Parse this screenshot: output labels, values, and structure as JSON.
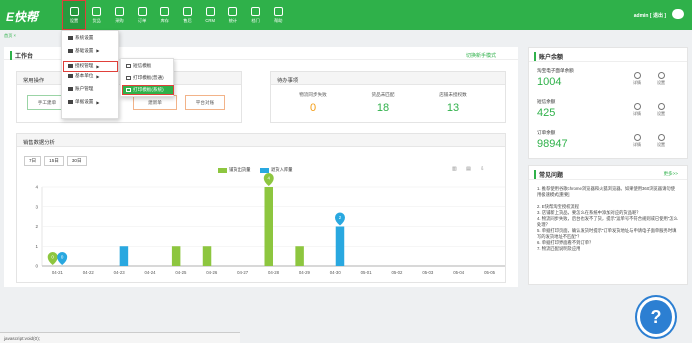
{
  "app": {
    "logo": "E快帮",
    "user": "admin",
    "logout": "[ 退出 ]"
  },
  "nav": [
    {
      "label": "设置",
      "icon": "gear-icon",
      "active": true
    },
    {
      "label": "货品",
      "icon": "box-icon"
    },
    {
      "label": "采购",
      "icon": "cart-icon"
    },
    {
      "label": "订单",
      "icon": "order-icon"
    },
    {
      "label": "库存",
      "icon": "warehouse-icon"
    },
    {
      "label": "售后",
      "icon": "service-icon"
    },
    {
      "label": "CRM",
      "icon": "crm-icon"
    },
    {
      "label": "统计",
      "icon": "stats-icon"
    },
    {
      "label": "档门",
      "icon": "door-icon"
    },
    {
      "label": "帮助",
      "icon": "help-icon"
    }
  ],
  "breadcrumb": "首页 ×",
  "dropdown": [
    {
      "label": "系统设置",
      "arrow": ""
    },
    {
      "label": "基础设置",
      "arrow": "▶"
    },
    {
      "label": "授权管理",
      "arrow": "▶",
      "selected": true
    },
    {
      "label": "基本单位",
      "arrow": "▶"
    },
    {
      "label": "账户管理",
      "arrow": ""
    },
    {
      "label": "单据设置",
      "arrow": "▶"
    }
  ],
  "submenu": [
    {
      "label": "短信模板"
    },
    {
      "label": "打印模板(普通)"
    },
    {
      "label": "打印模板(系统)",
      "highlighted": true
    }
  ],
  "workbench": {
    "title": "工作台",
    "switch_label": "切换新手模式"
  },
  "common_ops": {
    "title": "常用操作",
    "buttons": [
      "手工建单",
      "平台对账"
    ],
    "partial": "建新单"
  },
  "pending": {
    "title": "待办事项",
    "items": [
      {
        "label": "物流同步失败",
        "value": "0",
        "color": "#f39c12"
      },
      {
        "label": "货品未匹配",
        "value": "18",
        "color": "#2fb14a"
      },
      {
        "label": "店铺未授权数",
        "value": "13",
        "color": "#2fb14a"
      }
    ]
  },
  "sales": {
    "title": "销售数据分析",
    "tabs": [
      "7日",
      "15日",
      "30日"
    ],
    "legend": [
      {
        "name": "铺货出货量",
        "color": "#8dc63f"
      },
      {
        "name": "退货入库量",
        "color": "#29a8e0"
      }
    ]
  },
  "chart_data": {
    "type": "bar",
    "categories": [
      "04-21",
      "04-22",
      "04-23",
      "04-24",
      "04-25",
      "04-26",
      "04-27",
      "04-28",
      "04-29",
      "04-30",
      "05-01",
      "05-02",
      "05-03",
      "05-04",
      "05-05"
    ],
    "series": [
      {
        "name": "铺货出货量",
        "color": "#8dc63f",
        "values": [
          0,
          0,
          0,
          0,
          1,
          1,
          0,
          4,
          1,
          0,
          0,
          0,
          0,
          0,
          0
        ]
      },
      {
        "name": "退货入库量",
        "color": "#29a8e0",
        "values": [
          0,
          0,
          1,
          0,
          0,
          0,
          0,
          0,
          0,
          2,
          0,
          0,
          0,
          0,
          0
        ]
      }
    ],
    "yticks": [
      "0",
      "1",
      "2",
      "3",
      "4"
    ],
    "ylim": [
      0,
      4
    ],
    "markers": [
      {
        "category": "04-21",
        "series": 0,
        "label": "0"
      },
      {
        "category": "04-21",
        "series": 1,
        "label": "0"
      },
      {
        "category": "04-28",
        "series": 0,
        "label": "4"
      },
      {
        "category": "04-30",
        "series": 1,
        "label": "2"
      }
    ]
  },
  "account": {
    "title": "账户余额",
    "items": [
      {
        "label": "淘宝电子面单余额",
        "value": "1004"
      },
      {
        "label": "短信余额",
        "value": "425"
      },
      {
        "label": "订单余额",
        "value": "98947"
      }
    ],
    "actions": [
      "详情",
      "设置"
    ]
  },
  "faq": {
    "title": "常见问题",
    "more": "更多>>",
    "items": [
      "1. 推荐使用谷歌chrome浏览器和火狐浏览器。如果使用360浏览器请勿使用极速模式[重要]",
      "2. E快帮淘宝授权流程",
      "3. 店铺新上货品，要怎么在系统中添加对应的货品呢？",
      "4. 物流同步失败，后台也发不了货，提示“运单号不符合规则或已使用”怎么处理？",
      "5. 单据打印页面，确认发货时提示“订单发货地址与申请电子面单服务时填写的发货地址不匹配”？",
      "6. 单据打印界面看不到订单？",
      "7. 物流匹配说明及应用"
    ]
  },
  "status_bar": "javascript:void(0);"
}
